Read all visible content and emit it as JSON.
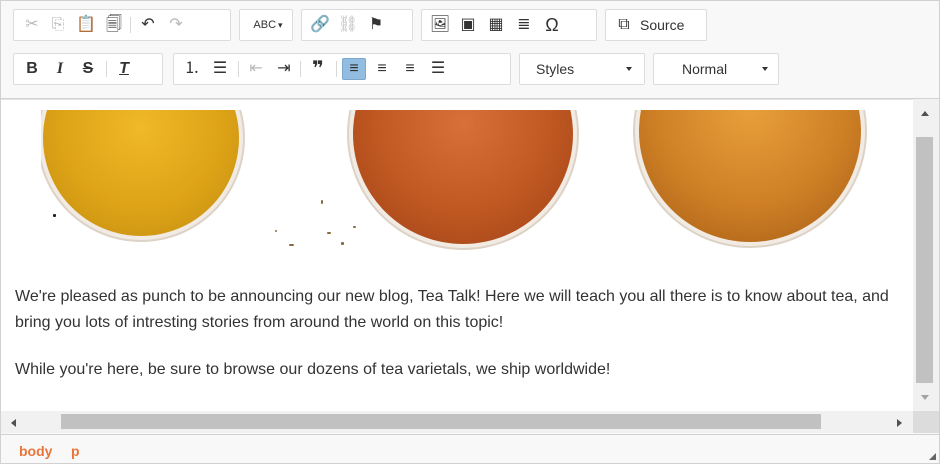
{
  "toolbar": {
    "source_label": "Source",
    "styles_combo": "Styles",
    "format_combo": "Normal",
    "spellcheck_label": "ABC"
  },
  "content": {
    "paragraphs": [
      "We're pleased as punch to be announcing our new blog, Tea Talk! Here we will teach you all there is to know about tea, and bring you lots of intresting stories from around the world on this topic!",
      "While you're here, be sure to browse our dozens of tea varietals, we ship worldwide!"
    ]
  },
  "path_bar": {
    "items": [
      "body",
      "p"
    ]
  },
  "colors": {
    "path_accent": "#e8753a",
    "active_button": "#92bce0"
  }
}
